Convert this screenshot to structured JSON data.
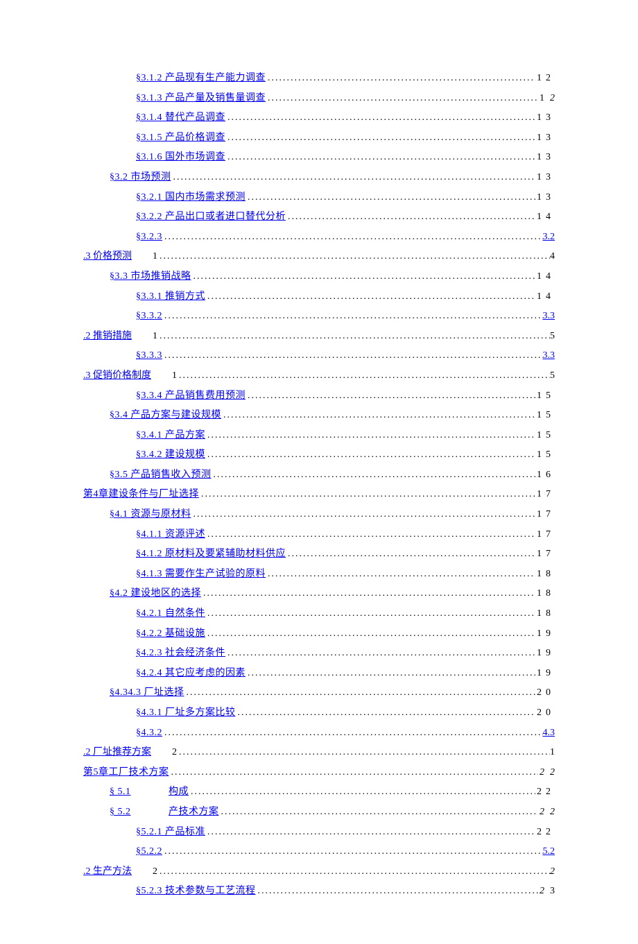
{
  "entries": [
    {
      "indent": 2,
      "type": "std",
      "label": "§3.1.2 产品现有生产能力调查",
      "page": "12"
    },
    {
      "indent": 2,
      "type": "std",
      "label": "§3.1.3 产品产量及销售量调查",
      "page": "1",
      "trail_italic": "2"
    },
    {
      "indent": 2,
      "type": "std",
      "label": "§3.1.4 替代产品调查",
      "page": "13"
    },
    {
      "indent": 2,
      "type": "std",
      "label": "§3.1.5 产品价格调查",
      "page": "13"
    },
    {
      "indent": 2,
      "type": "std",
      "label": "§3.1.6 国外市场调查",
      "page": "13"
    },
    {
      "indent": 1,
      "type": "std",
      "label": "§3.2 市场预测",
      "page": "13"
    },
    {
      "indent": 2,
      "type": "std",
      "label": "§3.2.1 国内市场需求预测",
      "page": "13"
    },
    {
      "indent": 2,
      "type": "std",
      "label": "§3.2.2 产品出口或者进口替代分析",
      "page": "14"
    },
    {
      "indent": 2,
      "type": "split",
      "label": "§3.2.3",
      "trail_link": "3.2",
      "cont_label": ".3 价格预测",
      "cont_num": "1",
      "cont_page": "4"
    },
    {
      "indent": 1,
      "type": "std",
      "label": "§3.3 市场推销战略",
      "page": "14"
    },
    {
      "indent": 2,
      "type": "std",
      "label": "§3.3.1 推销方式",
      "page": "14"
    },
    {
      "indent": 2,
      "type": "split",
      "label": "§3.3.2",
      "trail_link": "3.3",
      "cont_label": ".2 推销措施",
      "cont_num": "1",
      "cont_page": "5"
    },
    {
      "indent": 2,
      "type": "split",
      "label": "§3.3.3",
      "trail_link": "3.3",
      "cont_label": ".3 促销价格制度",
      "cont_num": "1",
      "cont_page": "5"
    },
    {
      "indent": 2,
      "type": "std",
      "label": "§3.3.4 产品销售费用预测",
      "page": "15"
    },
    {
      "indent": 1,
      "type": "std",
      "label": "§3.4 产品方案与建设规模",
      "page": "15"
    },
    {
      "indent": 2,
      "type": "std",
      "label": "§3.4.1 产品方案",
      "page": "15"
    },
    {
      "indent": 2,
      "type": "std",
      "label": "§3.4.2 建设规模",
      "page": "15"
    },
    {
      "indent": 1,
      "type": "std",
      "label": "§3.5 产品销售收入预测",
      "page": "16"
    },
    {
      "indent": 0,
      "type": "std",
      "label": "第4章建设条件与厂址选择",
      "page": "17"
    },
    {
      "indent": 1,
      "type": "std",
      "label": "§4.1 资源与原材料",
      "page": "17"
    },
    {
      "indent": 2,
      "type": "std",
      "label": "§4.1.1 资源评述",
      "page": "17"
    },
    {
      "indent": 2,
      "type": "std",
      "label": "§4.1.2 原材料及要紧辅助材料供应",
      "page": "17"
    },
    {
      "indent": 2,
      "type": "std",
      "label": "§4.1.3 需要作生产试验的原料",
      "page": "18"
    },
    {
      "indent": 1,
      "type": "std",
      "label": "§4.2 建设地区的选择",
      "page": "18"
    },
    {
      "indent": 2,
      "type": "std",
      "label": "§4.2.1 自然条件",
      "page": "18"
    },
    {
      "indent": 2,
      "type": "std",
      "label": "§4.2.2 基础设施",
      "page": "19"
    },
    {
      "indent": 2,
      "type": "std",
      "label": "§4.2.3 社会经济条件",
      "page": "19"
    },
    {
      "indent": 2,
      "type": "std",
      "label": "§4.2.4 其它应考虑的因素",
      "page": "19"
    },
    {
      "indent": 1,
      "type": "std",
      "label": "§4.34.3 厂址选择",
      "page": "20"
    },
    {
      "indent": 2,
      "type": "std",
      "label": "§4.3.1 厂址多方案比较",
      "page": "20"
    },
    {
      "indent": 2,
      "type": "split",
      "label": "§4.3.2",
      "trail_link": "4.3",
      "cont_label": ".2 厂址推荐方案",
      "cont_num": "2",
      "cont_page": "1"
    },
    {
      "indent": 0,
      "type": "std",
      "label": "第5章工厂技术方案",
      "page": "2",
      "page_italic": true,
      "trail_italic": "2"
    },
    {
      "indent": 1,
      "type": "wide",
      "num": "§ 5.1",
      "title": "构成",
      "page": "22"
    },
    {
      "indent": 1,
      "type": "wide",
      "num": "§ 5.2",
      "title": "产技术方案",
      "page": "2",
      "page_italic": true,
      "trail_italic": "2"
    },
    {
      "indent": 2,
      "type": "std",
      "label": "§5.2.1 产品标准",
      "page": "22"
    },
    {
      "indent": 2,
      "type": "split",
      "label": "§5.2.2",
      "trail_link": "5.2",
      "cont_label": ".2 生产方法",
      "cont_num": "2",
      "cont_page": "2",
      "cont_italic": true
    },
    {
      "indent": 2,
      "type": "std",
      "label": "§5.2.3 技术参数与工艺流程",
      "page": "2",
      "page_italic": true,
      "trail_plain": "3"
    }
  ]
}
